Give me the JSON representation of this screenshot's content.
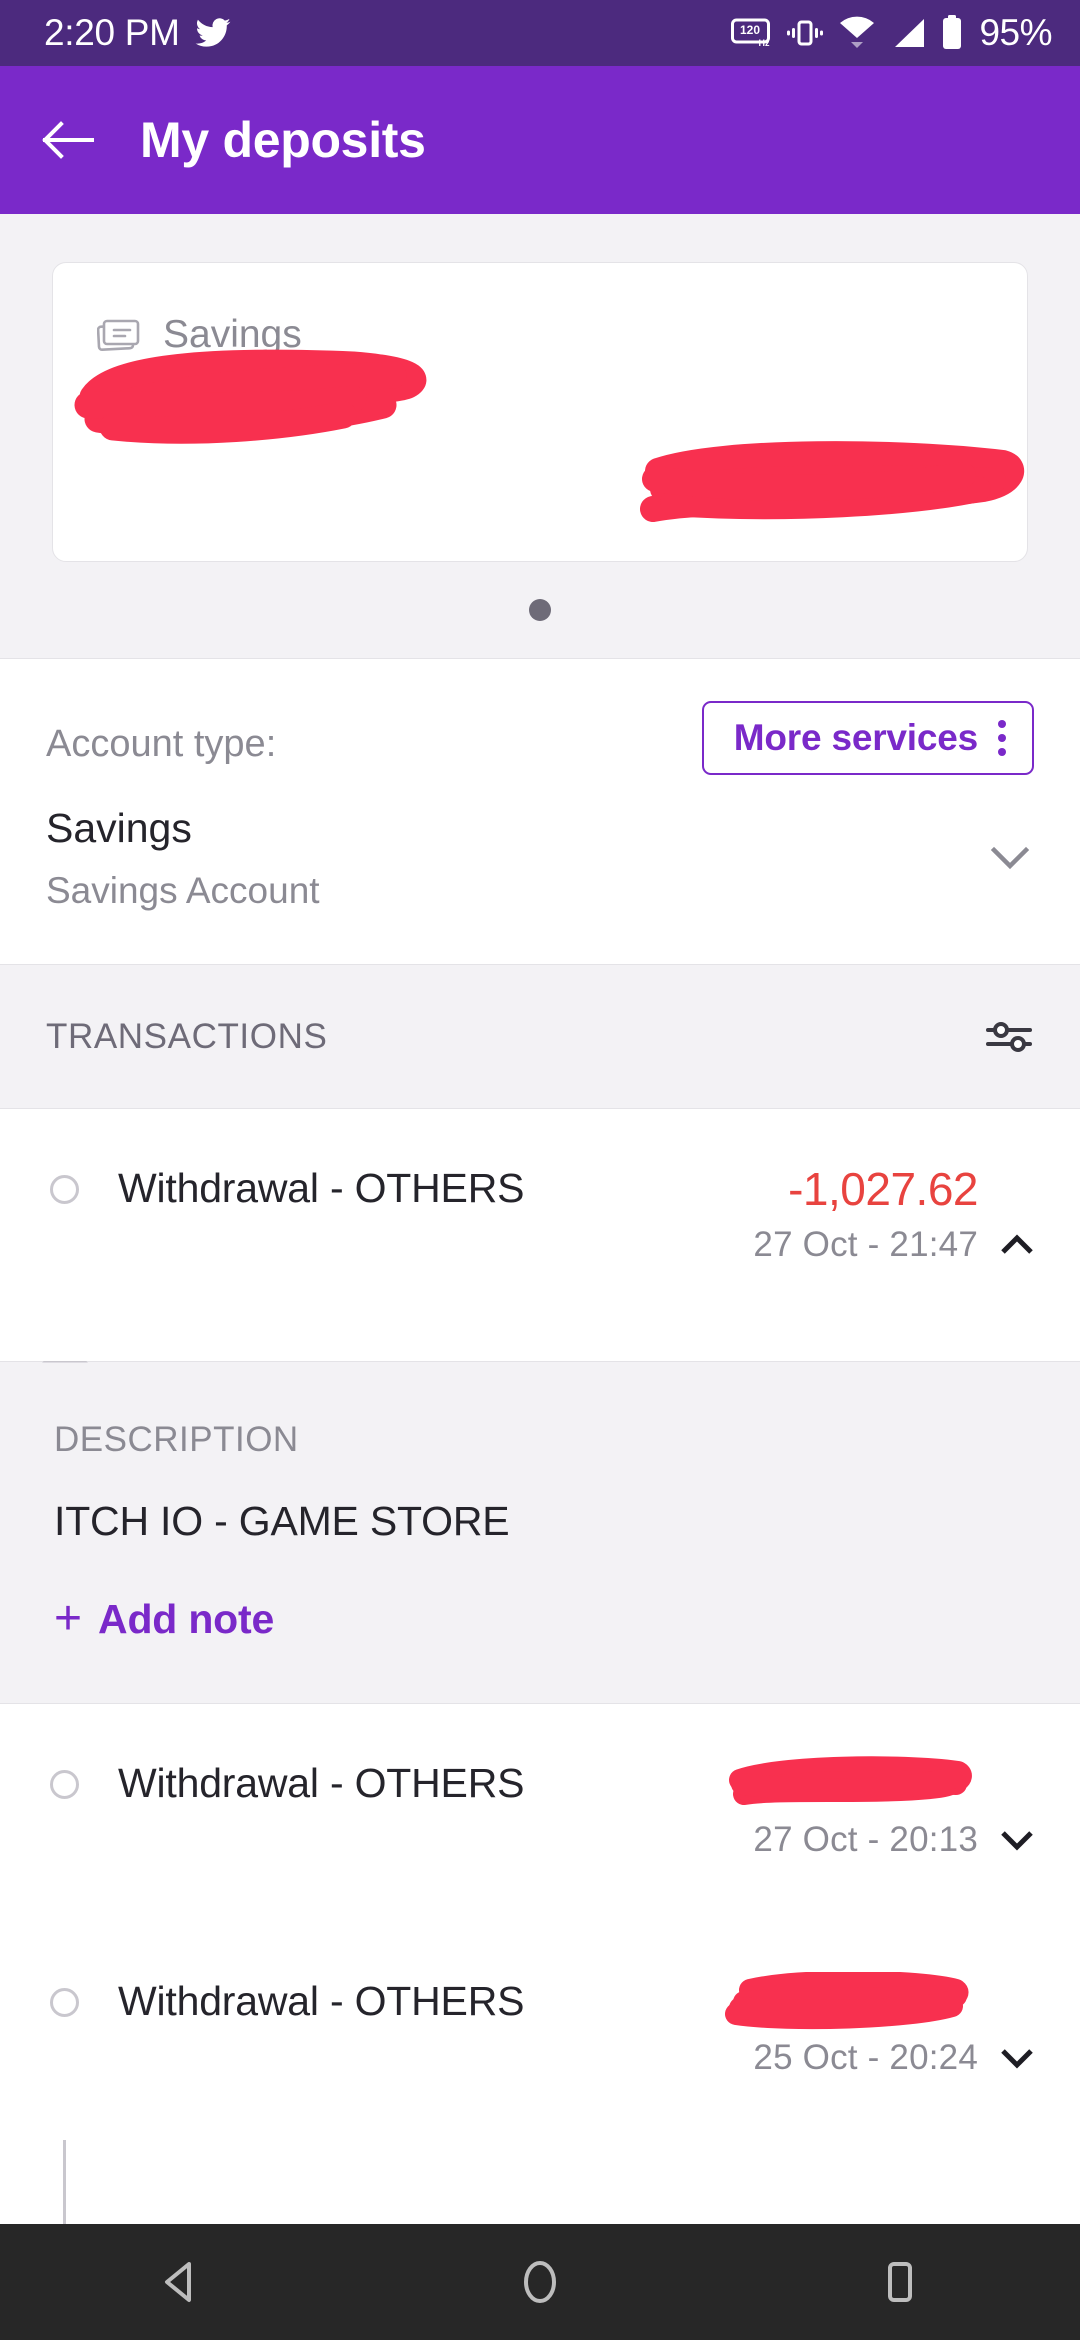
{
  "status_bar": {
    "clock": "2:20 PM",
    "battery_percent": "95%",
    "icons": [
      "twitter-icon",
      "refresh-rate-120hz-icon",
      "vibrate-icon",
      "wifi-icon",
      "cellular-signal-icon",
      "battery-icon"
    ],
    "background": "#4C2A7E"
  },
  "app_bar": {
    "title": "My deposits",
    "back_icon": "arrow-left-icon",
    "background": "#7A29C9"
  },
  "carousel": {
    "card": {
      "icon": "passbook-card-icon",
      "label": "Savings",
      "account_number_redacted": true,
      "balance_redacted": true
    },
    "page_indicator": {
      "count": 1,
      "active_index": 0
    }
  },
  "account_type": {
    "label": "Account type:",
    "value": "Savings",
    "subtitle": "Savings Account",
    "expand_icon": "chevron-down-icon",
    "more_services": {
      "label": "More services",
      "overflow_icon": "kebab-menu-icon",
      "accent": "#7A29C9"
    }
  },
  "transactions_section": {
    "title": "TRANSACTIONS",
    "filter_icon": "tune-filter-icon",
    "rows": [
      {
        "title": "Withdrawal - OTHERS",
        "amount": "-1,027.62",
        "amount_color": "#E8433F",
        "amount_redacted": false,
        "date": "27 Oct - 21:47",
        "expanded": true,
        "chevron_icon": "chevron-up-icon",
        "detail": {
          "caption": "DESCRIPTION",
          "value": "ITCH IO - GAME STORE",
          "add_note_label": "Add note",
          "add_note_icon": "plus-icon"
        }
      },
      {
        "title": "Withdrawal - OTHERS",
        "amount": "",
        "amount_color": "#E8433F",
        "amount_redacted": true,
        "date": "27 Oct - 20:13",
        "expanded": false,
        "chevron_icon": "chevron-down-icon"
      },
      {
        "title": "Withdrawal - OTHERS",
        "amount": "",
        "amount_color": "#E8433F",
        "amount_redacted": true,
        "date": "25 Oct - 20:24",
        "expanded": false,
        "chevron_icon": "chevron-down-icon"
      }
    ]
  },
  "nav_bar": {
    "back_icon": "nav-back-triangle-icon",
    "home_icon": "nav-home-circle-icon",
    "recents_icon": "nav-recents-square-icon",
    "background": "#272727"
  },
  "redaction_color": "#F8304F"
}
